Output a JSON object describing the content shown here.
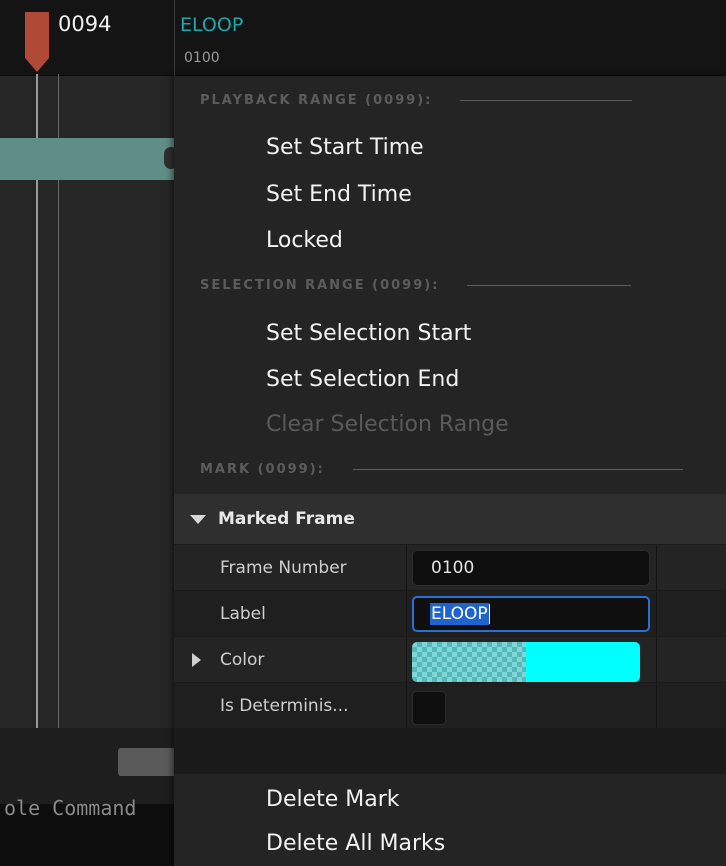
{
  "timeline": {
    "playhead_frame": "0094",
    "mark_label": "ELOOP",
    "mark_frame": "0100",
    "console_text": "ole Command"
  },
  "menu": {
    "playback_header": "PLAYBACK RANGE (0099):",
    "playback_items": [
      "Set Start Time",
      "Set End Time",
      "Locked"
    ],
    "selection_header": "SELECTION RANGE (0099):",
    "selection_items": [
      "Set Selection Start",
      "Set Selection End"
    ],
    "selection_disabled_item": "Clear Selection Range",
    "mark_header": "MARK (0099):",
    "details": {
      "title": "Marked Frame",
      "frame_number_label": "Frame Number",
      "frame_number_value": "0100",
      "label_label": "Label",
      "label_value": "ELOOP",
      "color_label": "Color",
      "color_value": "#00ffff",
      "deterministic_label": "Is Determinis..."
    },
    "delete_mark": "Delete Mark",
    "delete_all_marks": "Delete All Marks"
  },
  "colors": {
    "playhead": "#b04a36",
    "mark": "#1ba8ad",
    "selection": "#1f63cc",
    "focus_border": "#2b6fd1"
  },
  "icons": {
    "playhead": "playhead-flag-icon",
    "collapse": "triangle-down-icon",
    "expand": "triangle-right-icon"
  }
}
